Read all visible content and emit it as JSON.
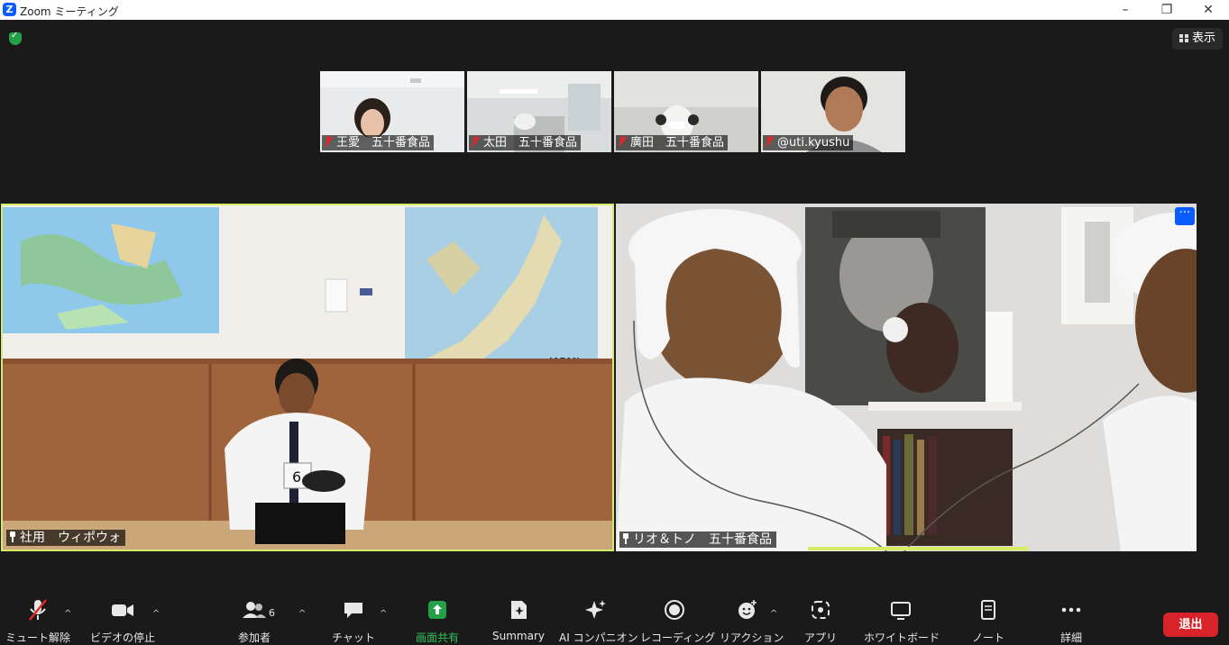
{
  "window": {
    "title": "Zoom ミーティング",
    "logo": "Z",
    "minimize": "–",
    "maximize": "❐",
    "close": "✕"
  },
  "view_button": {
    "label": "表示",
    "icon": "grid-icon"
  },
  "thumbnails": [
    {
      "name": "王愛　五十番食品",
      "muted": true
    },
    {
      "name": "太田　五十番食品",
      "muted": true
    },
    {
      "name": "廣田　五十番食品",
      "muted": true
    },
    {
      "name": "@uti.kyushu",
      "muted": true
    }
  ],
  "main_tiles": [
    {
      "name": "社用　ウィポウォ",
      "pinned": true,
      "active_speaker": true,
      "map_label": "JAPAN",
      "badge": "6"
    },
    {
      "name": "リオ＆トノ　五十番食品",
      "pinned": true,
      "more": "···"
    }
  ],
  "toolbar": {
    "mute": "ミュート解除",
    "video": "ビデオの停止",
    "participants": "参加者",
    "participants_count": "6",
    "chat": "チャット",
    "share": "画面共有",
    "summary": "Summary",
    "ai": "AI コンパニオン",
    "record": "レコーディング",
    "reactions": "リアクション",
    "apps": "アプリ",
    "whiteboard": "ホワイトボード",
    "notes": "ノート",
    "more": "詳細",
    "leave": "退出",
    "caret": "^"
  },
  "colors": {
    "background": "#1a1a1a",
    "active_speaker_border": "#d6ec66",
    "share_green": "#24a148",
    "leave_red": "#d8232a",
    "accent_blue": "#0b5cff",
    "muted_red": "#e02828"
  }
}
